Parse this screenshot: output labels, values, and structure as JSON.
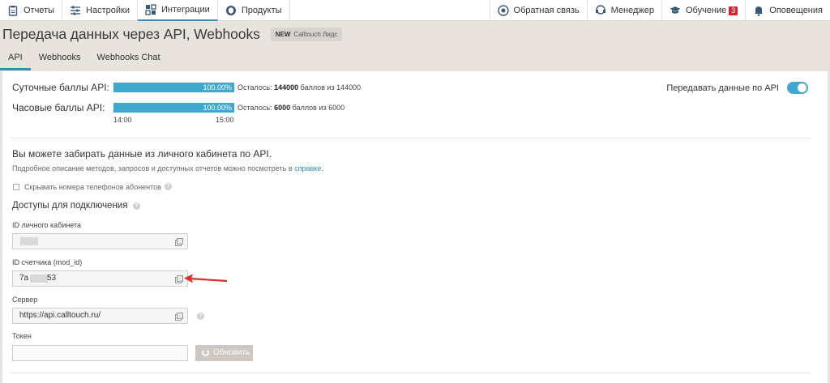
{
  "nav": {
    "left": [
      {
        "label": "Отчеты",
        "icon": "clipboard-icon"
      },
      {
        "label": "Настройки",
        "icon": "sliders-icon"
      },
      {
        "label": "Интеграции",
        "icon": "integrations-icon",
        "active": true
      },
      {
        "label": "Продукты",
        "icon": "products-icon"
      }
    ],
    "right": {
      "feedback": "Обратная связь",
      "manager": "Менеджер",
      "learning": "Обучение",
      "learning_badge": "3",
      "alerts": "Оповещения"
    }
  },
  "page": {
    "title": "Передача данных через API, Webhooks",
    "badge_new": "NEW",
    "badge_text": "Calltouch Лидс"
  },
  "tabs": [
    "API",
    "Webhooks",
    "Webhooks Chat"
  ],
  "quotas": {
    "daily": {
      "label": "Суточные баллы API:",
      "percent_text": "100.00%",
      "percent": 100,
      "remaining_prefix": "Осталось: ",
      "remaining": "144000",
      "remaining_suffix": " баллов из 144000"
    },
    "hourly": {
      "label": "Часовые баллы API:",
      "percent_text": "100.00%",
      "percent": 100,
      "remaining_prefix": "Осталось: ",
      "remaining": "6000",
      "remaining_suffix": " баллов из 6000",
      "time_start": "14:00",
      "time_end": "15:00"
    }
  },
  "toggle": {
    "label": "Передавать данные по API",
    "on": true
  },
  "info": {
    "heading": "Вы можете забирать данные из личного кабинета по API.",
    "desc_prefix": "Подробное описание методов, запросов и доступных отчетов можно посмотреть в ",
    "desc_link": "справке",
    "desc_suffix": "."
  },
  "hide_phones": {
    "label": "Скрывать номера телефонов абонентов",
    "checked": false
  },
  "access": {
    "heading": "Доступы для подключения",
    "cabinet_id": {
      "label": "ID личного кабинета",
      "value": ""
    },
    "counter_id": {
      "label": "ID счетчика (mod_id)",
      "value_start": "7a",
      "value_end": "53"
    },
    "server": {
      "label": "Сервер",
      "value": "https://api.calltouch.ru/"
    },
    "token": {
      "label": "Токен",
      "value": "",
      "refresh_label": "Обновить"
    }
  },
  "colors": {
    "accent": "#3fa8cd",
    "arrow": "#d9302b",
    "background": "#e9e3de"
  }
}
